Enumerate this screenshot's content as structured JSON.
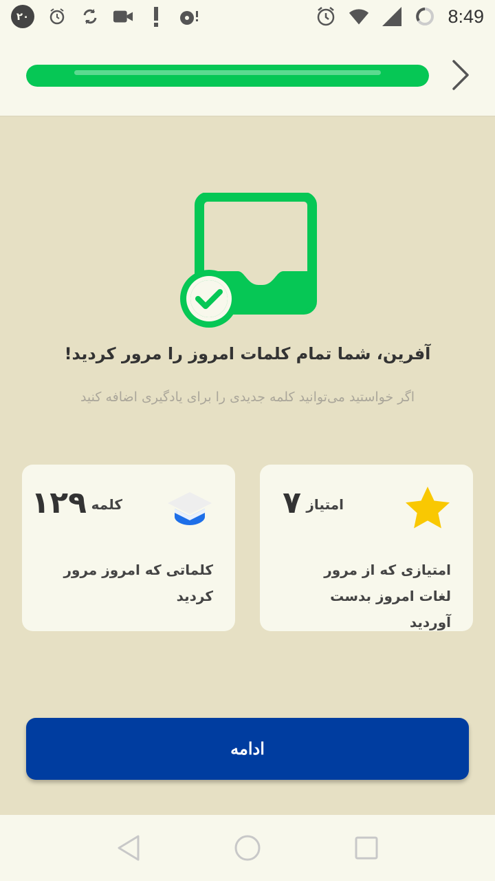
{
  "status_bar": {
    "notification_badge": "۲۰",
    "time": "8:49"
  },
  "progress": {
    "value": 1.0,
    "color": "#06c755"
  },
  "main": {
    "headline": "آفرین، شما تمام کلمات امروز را مرور کردید!",
    "subline": "اگر خواستید می‌توانید کلمه جدیدی را برای یادگیری اضافه کنید"
  },
  "cards": {
    "score": {
      "icon": "star-icon",
      "label": "امتیاز",
      "value": "۷",
      "description": "امتیازی که از مرور لغات امروز بدست آوردید"
    },
    "words": {
      "icon": "graduation-cap-icon",
      "label": "کلمه",
      "value": "۱۲۹",
      "description": "کلماتی که امروز مرور کردید"
    }
  },
  "actions": {
    "continue_label": "ادامه"
  },
  "colors": {
    "accent_green": "#06c755",
    "primary_blue": "#003da0",
    "background": "#e6e0c4",
    "star": "#f9c802"
  }
}
